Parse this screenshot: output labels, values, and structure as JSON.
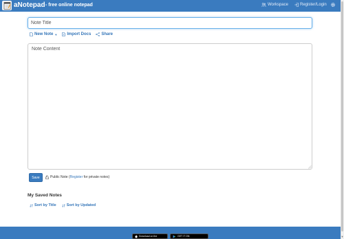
{
  "navbar": {
    "brand": "aNotepad",
    "tagline": "- free online notepad",
    "workspace": "Workspace",
    "register_login": "Register/Login",
    "icons": [
      "notepad-logo-icon",
      "people-icon",
      "login-icon",
      "gear-icon"
    ]
  },
  "editor": {
    "title_placeholder": "Note Title",
    "content_placeholder": "Note Content"
  },
  "toolbar": {
    "new_note": "New Note",
    "import_docs": "Import Docs",
    "share": "Share"
  },
  "save": {
    "button": "Save",
    "public_note": "Public Note (",
    "register": "Register",
    "private_suffix": " for private notes)"
  },
  "saved_notes": {
    "heading": "My Saved Notes",
    "sort_title": "Sort by Title",
    "sort_updated": "Sort by Updated"
  },
  "footer": {
    "apple": "Download on the",
    "google": "GET IT ON"
  },
  "colors": {
    "accent": "#3a7bbf",
    "link": "#3274b8"
  }
}
